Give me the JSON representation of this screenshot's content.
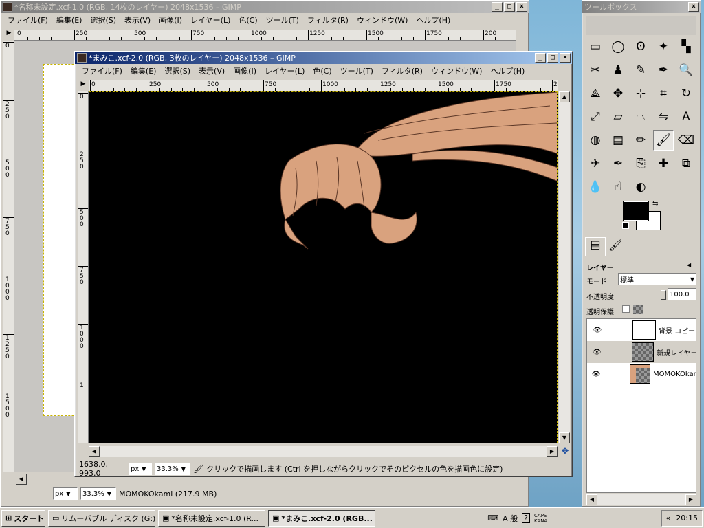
{
  "back_window": {
    "title": "*名称未設定.xcf-1.0 (RGB, 14枚のレイヤー) 2048x1536 – GIMP",
    "menu": [
      "ファイル(F)",
      "編集(E)",
      "選択(S)",
      "表示(V)",
      "画像(I)",
      "レイヤー(L)",
      "色(C)",
      "ツール(T)",
      "フィルタ(R)",
      "ウィンドウ(W)",
      "ヘルプ(H)"
    ],
    "ruler_h": [
      "0",
      "250",
      "500",
      "750",
      "1000",
      "1250",
      "1500",
      "1750",
      "200"
    ],
    "ruler_v": [
      "0",
      "250",
      "500",
      "750",
      "1000",
      "1250",
      "1500"
    ],
    "status": {
      "unit": "px",
      "zoom": "33.3%",
      "text": "MOMOKOkami (217.9 MB)"
    }
  },
  "front_window": {
    "title": "*まみこ.xcf-2.0 (RGB, 3枚のレイヤー) 2048x1536 – GIMP",
    "menu": [
      "ファイル(F)",
      "編集(E)",
      "選択(S)",
      "表示(V)",
      "画像(I)",
      "レイヤー(L)",
      "色(C)",
      "ツール(T)",
      "フィルタ(R)",
      "ウィンドウ(W)",
      "ヘルプ(H)"
    ],
    "ruler_h": [
      "0",
      "250",
      "500",
      "750",
      "1000",
      "1250",
      "1500",
      "1750",
      "200"
    ],
    "ruler_v": [
      "0",
      "250",
      "500",
      "750",
      "1000",
      "1"
    ],
    "status": {
      "coords": "1638.0, 993.0",
      "unit": "px",
      "zoom": "33.3%",
      "message": "クリックで描画します (Ctrl を押しながらクリックでそのピクセルの色を描画色に設定)"
    },
    "canvas": {
      "background": "#000000",
      "hair_color": "#d9a27e",
      "hair_line": "#5a3626"
    }
  },
  "toolbox": {
    "title": "ツールボックス",
    "tools": [
      "rect-select",
      "ellipse-select",
      "lasso",
      "fuzzy-select",
      "color-select",
      "scissors",
      "foreground-select",
      "paths",
      "color-picker",
      "zoom",
      "measure",
      "move",
      "align",
      "crop",
      "rotate",
      "scale",
      "shear",
      "perspective",
      "flip",
      "text",
      "bucket-fill",
      "blend",
      "pencil",
      "paintbrush",
      "eraser",
      "airbrush",
      "ink",
      "clone",
      "heal",
      "perspective-clone",
      "blur",
      "smudge",
      "dodge-burn"
    ],
    "selected_tool": "paintbrush",
    "fg_color": "#000000",
    "bg_color": "#ffffff"
  },
  "layers": {
    "heading": "レイヤー",
    "mode_label": "モード",
    "mode_value": "標準",
    "opacity_label": "不透明度",
    "opacity_value": "100.0",
    "opacity_fraction": 1.0,
    "lock_label": "透明保護",
    "items": [
      {
        "name": "背景 コピー",
        "thumb": "white"
      },
      {
        "name": "新規レイヤー",
        "thumb": "checker"
      },
      {
        "name": "MOMOKOkami",
        "thumb": "hair"
      }
    ]
  },
  "taskbar": {
    "start": "スタート",
    "items": [
      "リムーバブル ディスク (G:)",
      "*名称未設定.xcf-1.0 (R...",
      "*まみこ.xcf-2.0 (RGB..."
    ],
    "active_index": 2,
    "tray_caps": "CAPS",
    "tray_kana": "KANA",
    "ime": "A 般",
    "clock": "20:15"
  }
}
